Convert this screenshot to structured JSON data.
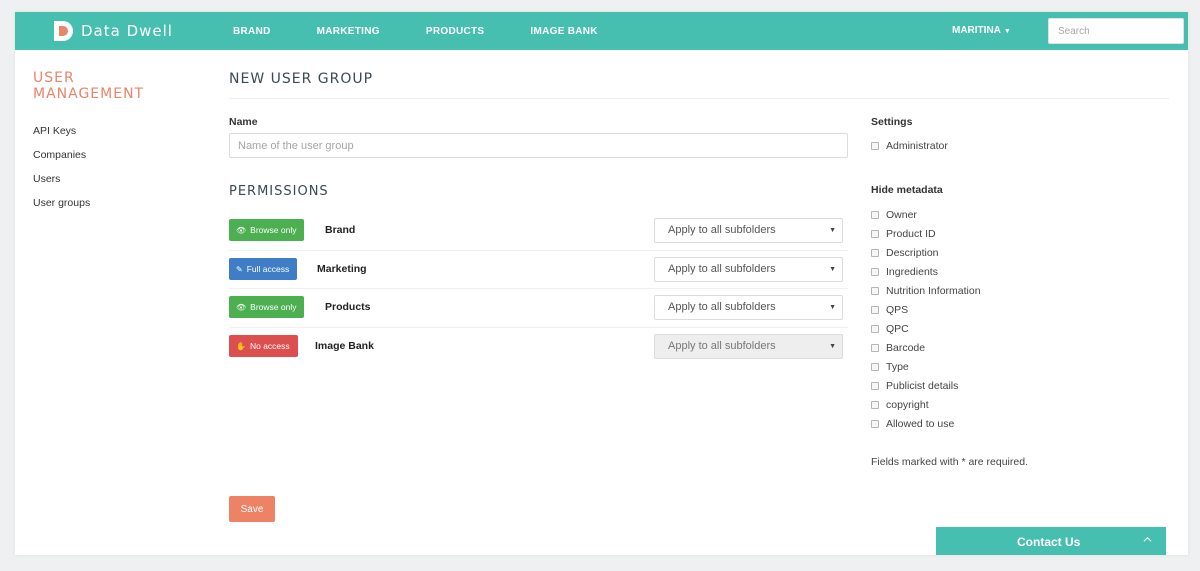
{
  "header": {
    "logo_text": "Data Dwell",
    "nav": [
      "BRAND",
      "MARKETING",
      "PRODUCTS",
      "IMAGE BANK"
    ],
    "user": "MARITINA",
    "search_placeholder": "Search"
  },
  "sidebar": {
    "title": "USER MANAGEMENT",
    "items": [
      "API Keys",
      "Companies",
      "Users",
      "User groups"
    ]
  },
  "main": {
    "title": "NEW USER GROUP",
    "name_label": "Name",
    "name_placeholder": "Name of the user group",
    "permissions_title": "PERMISSIONS",
    "permissions": [
      {
        "access": "Browse only",
        "access_icon": "eye-icon",
        "folder": "Brand",
        "scope": "Apply to all subfolders",
        "disabled": false
      },
      {
        "access": "Full access",
        "access_icon": "pencil-icon",
        "folder": "Marketing",
        "scope": "Apply to all subfolders",
        "disabled": false
      },
      {
        "access": "Browse only",
        "access_icon": "eye-icon",
        "folder": "Products",
        "scope": "Apply to all subfolders",
        "disabled": false
      },
      {
        "access": "No access",
        "access_icon": "hand-icon",
        "folder": "Image Bank",
        "scope": "Apply to all subfolders",
        "disabled": true
      }
    ],
    "save_label": "Save"
  },
  "settings": {
    "label": "Settings",
    "administrator": "Administrator",
    "hide_metadata_label": "Hide metadata",
    "metadata": [
      "Owner",
      "Product ID",
      "Description",
      "Ingredients",
      "Nutrition Information",
      "QPS",
      "QPC",
      "Barcode",
      "Type",
      "Publicist details",
      "copyright",
      "Allowed to use"
    ],
    "required_note": "Fields marked with * are required."
  },
  "contact": {
    "label": "Contact Us"
  },
  "colors": {
    "teal": "#47bfb0",
    "accent_orange": "#ee8264",
    "browse_green": "#4caf50",
    "full_blue": "#3f7dc6",
    "no_access_red": "#dd4f4f"
  }
}
